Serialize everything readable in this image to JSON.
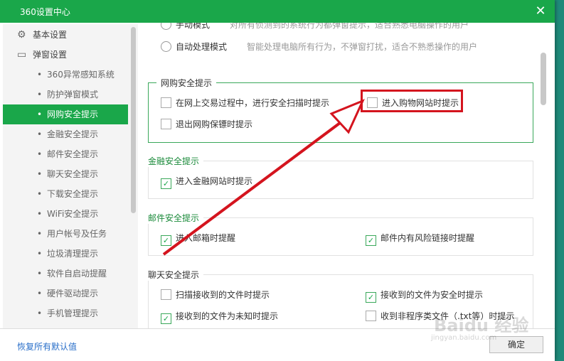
{
  "window": {
    "title": "360设置中心",
    "close_glyph": "✕"
  },
  "sidebar": {
    "top_items": [
      {
        "label": "基本设置",
        "icon": "gear-icon"
      },
      {
        "label": "弹窗设置",
        "icon": "window-icon"
      }
    ],
    "sub_items": [
      {
        "label": "360异常感知系统"
      },
      {
        "label": "防护弹窗模式"
      },
      {
        "label": "网购安全提示",
        "active": true
      },
      {
        "label": "金融安全提示"
      },
      {
        "label": "邮件安全提示"
      },
      {
        "label": "聊天安全提示"
      },
      {
        "label": "下载安全提示"
      },
      {
        "label": "WiFi安全提示"
      },
      {
        "label": "用户帐号及任务"
      },
      {
        "label": "垃圾清理提示"
      },
      {
        "label": "软件自启动提醒"
      },
      {
        "label": "硬件驱动提示"
      },
      {
        "label": "手机管理提示"
      }
    ]
  },
  "mode": {
    "manual_label": "手动模式",
    "manual_desc": "对所有侦测到的系统行为都弹窗提示，适合熟悉电脑操作的用户",
    "auto_label": "自动处理模式",
    "auto_desc": "智能处理电脑所有行为，不弹窗打扰，适合不熟悉操作的用户"
  },
  "shopping": {
    "title": "网购安全提示",
    "opt1": "在网上交易过程中，进行安全扫描时提示",
    "opt2": "进入购物网站时提示",
    "opt3": "退出网购保镖时提示"
  },
  "finance": {
    "title": "金融安全提示",
    "opt1": "进入金融网站时提示"
  },
  "mail": {
    "title": "邮件安全提示",
    "opt1": "进入邮箱时提醒",
    "opt2": "邮件内有风险链接时提醒"
  },
  "chat": {
    "title": "聊天安全提示",
    "opt1": "扫描接收到的文件时提示",
    "opt2": "接收到的文件为安全时提示",
    "opt3": "接收到的文件为未知时提示",
    "opt4": "收到非程序类文件（.txt等）时提示"
  },
  "footer": {
    "restore": "恢复所有默认值",
    "ok": "确定"
  },
  "watermark": {
    "main": "Baidu 经验",
    "sub": "jingyan.baidu.com"
  },
  "colors": {
    "accent": "#1aa74a",
    "highlight": "#d4141e"
  }
}
